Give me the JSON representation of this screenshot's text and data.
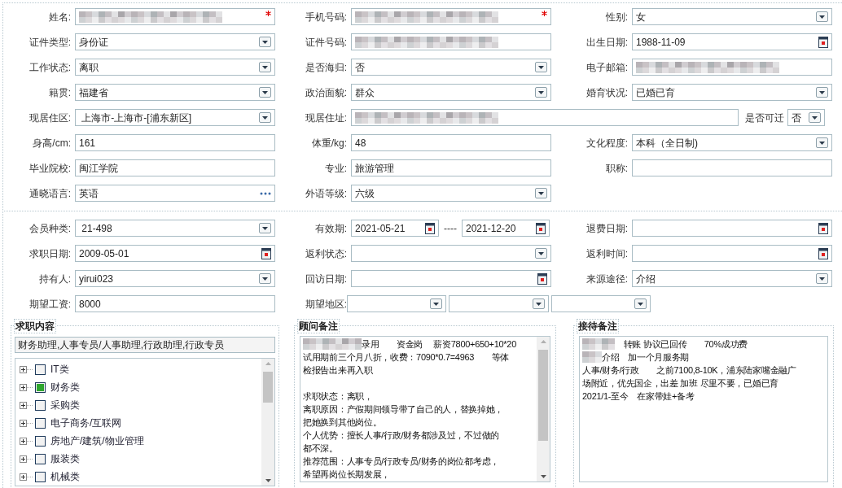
{
  "personal_rows": [
    [
      {
        "label": "姓名:",
        "kind": "blurred",
        "required": true
      },
      {
        "label": "手机号码:",
        "kind": "blurred",
        "required": true
      },
      {
        "label": "性别:",
        "kind": "select",
        "value": "女"
      }
    ],
    [
      {
        "label": "证件类型:",
        "kind": "select",
        "value": "身份证"
      },
      {
        "label": "证件号码:",
        "kind": "blurred"
      },
      {
        "label": "出生日期:",
        "kind": "date",
        "value": "1988-11-09"
      }
    ],
    [
      {
        "label": "工作状态:",
        "kind": "select",
        "value": "离职"
      },
      {
        "label": "是否海归:",
        "kind": "select",
        "value": "否"
      },
      {
        "label": "电子邮箱:",
        "kind": "blurred"
      }
    ],
    [
      {
        "label": "籍贯:",
        "kind": "select",
        "value": "福建省"
      },
      {
        "label": "政治面貌:",
        "kind": "select",
        "value": "群众"
      },
      {
        "label": "婚育状况:",
        "kind": "select",
        "value": "已婚已育"
      }
    ],
    [
      {
        "label": "现居住区:",
        "kind": "select",
        "value": " 上海市-上海市-[浦东新区]"
      },
      {
        "label": "现居住址:",
        "kind": "blurred",
        "wide": true
      },
      {
        "label": "是否可迁",
        "kind": "select",
        "value": "否",
        "compact": true
      }
    ],
    [
      {
        "label": "身高/cm:",
        "kind": "text",
        "value": "161"
      },
      {
        "label": "体重/kg:",
        "kind": "text",
        "value": "48"
      },
      {
        "label": "文化程度:",
        "kind": "select",
        "value": "本科（全日制)"
      }
    ],
    [
      {
        "label": "毕业院校:",
        "kind": "text",
        "value": "闽江学院"
      },
      {
        "label": "专业:",
        "kind": "text",
        "value": "旅游管理"
      },
      {
        "label": "职称:",
        "kind": "text"
      }
    ],
    [
      {
        "label": "通晓语言:",
        "kind": "more",
        "value": "英语"
      },
      {
        "label": "外语等级:",
        "kind": "select",
        "value": "六级"
      }
    ]
  ],
  "member_rows": [
    [
      {
        "label": "会员种类:",
        "kind": "select",
        "value": " 21-498"
      },
      {
        "label": "有效期:",
        "kind": "range",
        "value": "2021-05-21",
        "separator": "----",
        "value_end": "2021-12-20"
      },
      {
        "label": "退费日期:",
        "kind": "date"
      }
    ],
    [
      {
        "label": "求职日期:",
        "kind": "date",
        "value": "2009-05-01"
      },
      {
        "label": "返利状态:",
        "kind": "select"
      },
      {
        "label": "返利时间:",
        "kind": "date"
      }
    ],
    [
      {
        "label": "持有人:",
        "kind": "select",
        "value": "yirui023"
      },
      {
        "label": "回访日期:",
        "kind": "date"
      },
      {
        "label": "来源途径:",
        "kind": "select",
        "value": "介绍"
      }
    ],
    [
      {
        "label": "期望工资:",
        "kind": "text",
        "value": "8000"
      },
      {
        "label": "期望地区:",
        "kind": "selects"
      }
    ]
  ],
  "job_panel": {
    "title": "求职内容",
    "summary": "财务助理,人事专员/人事助理,行政助理,行政专员",
    "tree": [
      {
        "label": "IT类",
        "checked": false
      },
      {
        "label": "财务类",
        "checked": true
      },
      {
        "label": "采购类",
        "checked": false
      },
      {
        "label": "电子商务/互联网",
        "checked": false
      },
      {
        "label": "房地产/建筑/物业管理",
        "checked": false
      },
      {
        "label": "服装类",
        "checked": false
      },
      {
        "label": "机械类",
        "checked": false
      }
    ]
  },
  "advisor_panel": {
    "title": "顾问备注",
    "lines": [
      {
        "text": "录用　　资金岗　 薪资7800+650+10*20",
        "redacted": true
      },
      {
        "text": "试用期前三个月八折，收费：7090*0.7=4963　　等体",
        "redacted": false
      },
      {
        "text": "检报告出来再入职",
        "redacted": false
      },
      {
        "redacted": false
      },
      {
        "text": "求职状态：离职，",
        "redacted": false
      },
      {
        "text": "离职原因：产假期间领导带了自己的人，替换掉她，",
        "redacted": false
      },
      {
        "text": "把她换到其他岗位。",
        "redacted": false
      },
      {
        "text": "个人优势：擅长人事/行政/财务都涉及过，不过做的",
        "redacted": false
      },
      {
        "text": "都不深。",
        "redacted": false
      },
      {
        "text": "推荐范围：人事专员/行政专员/财务的岗位都考虑，",
        "redacted": false
      },
      {
        "text": "希望再岗位长期发展，",
        "redacted": false
      }
    ]
  },
  "reception_panel": {
    "title": "接待备注",
    "lines": [
      {
        "text": "　转账 协议已回传　　70%成功费",
        "redacted": true
      },
      {
        "text": "介绍　加一个月服务期",
        "redacted": true
      },
      {
        "text": "人事/财务/行政　　之前7100,8-10K，浦东陆家嘴金融广",
        "redacted": false
      },
      {
        "text": "场附近，优先国企，出差 加班 尽里不要，已婚已育",
        "redacted": false
      },
      {
        "text": "2021/1-至今　在家带娃+备考",
        "redacted": false
      }
    ]
  }
}
